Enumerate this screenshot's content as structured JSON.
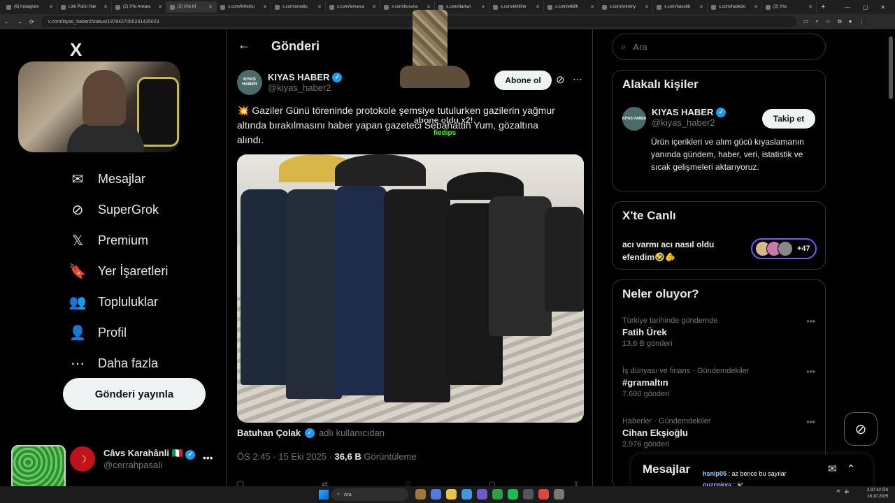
{
  "browser": {
    "tabs": [
      {
        "label": "(9) Instagram",
        "active": false
      },
      {
        "label": "Link Polisi Hak",
        "active": false
      },
      {
        "label": "(2) X'te Ankara",
        "active": false
      },
      {
        "label": "(2) X'te Kİ",
        "active": true
      },
      {
        "label": "x.com/Mrbohu",
        "active": false
      },
      {
        "label": "x.com/onedio",
        "active": false
      },
      {
        "label": "x.com/lemarca",
        "active": false
      },
      {
        "label": "x.com/bosuna",
        "active": false
      },
      {
        "label": "x.com/darkwi",
        "active": false
      },
      {
        "label": "x.com/etkilihe",
        "active": false
      },
      {
        "label": "x.com/etkilih",
        "active": false
      },
      {
        "label": "x.com/srkntny",
        "active": false
      },
      {
        "label": "x.com/nasuhb",
        "active": false
      },
      {
        "label": "x.com/haskolo",
        "active": false
      },
      {
        "label": "(2) X'te",
        "active": false
      }
    ],
    "url": "x.com/kiyas_haber2/status/1978427055231435023"
  },
  "sidebar": {
    "logo": "X",
    "nav": [
      {
        "label": "Mesajlar",
        "icon": "mail-icon",
        "glyph": "✉"
      },
      {
        "label": "SuperGrok",
        "icon": "grok-icon",
        "glyph": "⊘"
      },
      {
        "label": "Premium",
        "icon": "x-premium-icon",
        "glyph": "𝕏"
      },
      {
        "label": "Yer İşaretleri",
        "icon": "bookmark-icon",
        "glyph": "🔖"
      },
      {
        "label": "Topluluklar",
        "icon": "communities-icon",
        "glyph": "👥"
      },
      {
        "label": "Profil",
        "icon": "profile-icon",
        "glyph": "👤"
      },
      {
        "label": "Daha fazla",
        "icon": "more-circle-icon",
        "glyph": "⋯"
      }
    ],
    "post_button": "Gönderi yayınla",
    "account": {
      "name": "Câvs Karahânli 🇮🇹",
      "handle": "@cerrahpasaIi"
    }
  },
  "post": {
    "header_title": "Gönderi",
    "author": {
      "name": "KIYAS HABER",
      "handle": "@kiyas_haber2",
      "avatar_text": "KIYAS HABER"
    },
    "subscribe_label": "Abone ol",
    "text_emoji": "💥",
    "text": "Gaziler Günü töreninde protokole şemsiye tutulurken gazilerin yağmur altında bırakılmasını haber yapan gazeteci Sebahattin Yum, gözaltına alındı.",
    "credit_name": "Batuhan Çolak",
    "credit_tail": "adlı kullanıcıdan",
    "time": "ÖS 2:45 · 15 Eki 2025 · ",
    "views": "36,6 B",
    "views_label": "Görüntüleme",
    "overlay_text": "abone oldu x2!",
    "overlay_user": "fiedips"
  },
  "right": {
    "search_placeholder": "Ara",
    "related_title": "Alakalı kişiler",
    "related_user": {
      "name": "KIYAS HABER",
      "handle": "@kiyas_haber2",
      "follow_label": "Takip et",
      "bio": "Ürün içerikleri ve alım gücü kıyaslamanın yanında gündem, haber, veri, istatistik ve sıcak gelişmeleri aktarıyoruz."
    },
    "live_title": "X'te Canlı",
    "live_text": "acı varmı acı nasıl oldu efendim🤣🫵",
    "live_count": "+47",
    "trends_title": "Neler oluyor?",
    "trends": [
      {
        "category": "Türkiye tarihinde gündemde",
        "name": "Fatih Ürek",
        "count": "13,6 B gönderi"
      },
      {
        "category": "İş dünyası ve finans · Gündemdekiler",
        "name": "#gramaltın",
        "count": "7.690 gönderi"
      },
      {
        "category": "Haberler · Gündemdekiler",
        "name": "Cihan Ekşioğlu",
        "count": "2.976 gönderi"
      }
    ]
  },
  "messages_drawer": {
    "title": "Mesajlar",
    "chat": [
      {
        "user": "hsnlp05",
        "text": "az bence bu sayılar"
      },
      {
        "user": "ouzcnkya",
        "text": "🦅"
      }
    ]
  },
  "taskbar": {
    "search": "Ara",
    "time": "3:37:42 ÖS",
    "date": "16.10.2025"
  }
}
